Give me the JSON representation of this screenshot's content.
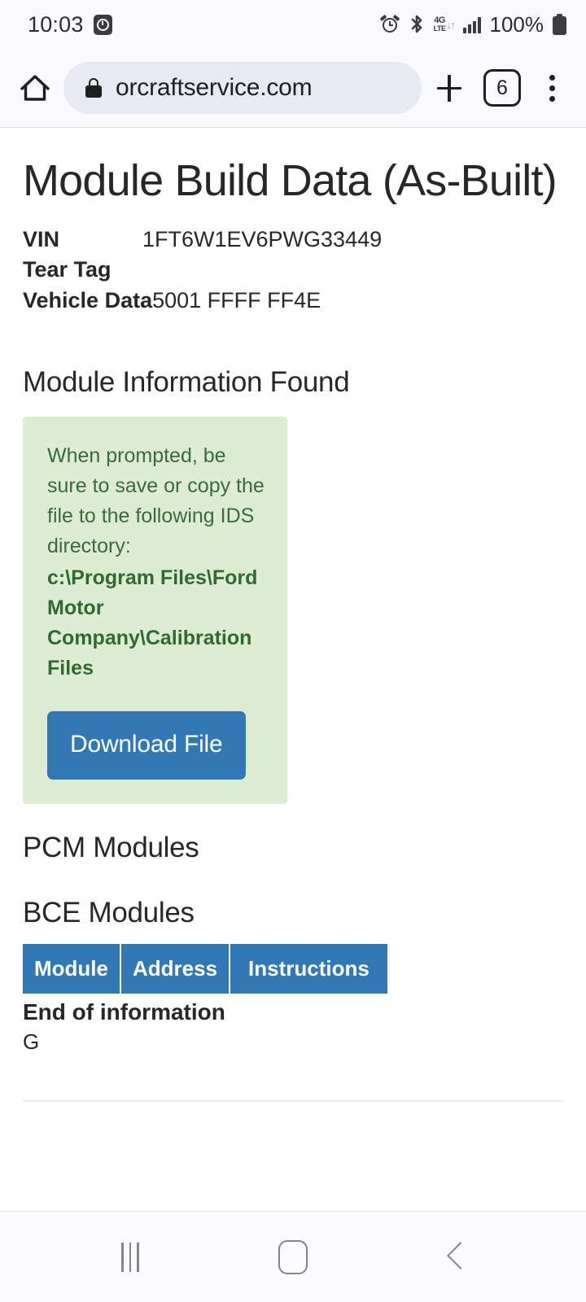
{
  "status_bar": {
    "time": "10:03",
    "battery_percent": "100%",
    "network_label_top": "4G",
    "network_label_bottom": "LTE",
    "icons": [
      "timer-icon",
      "alarm-icon",
      "bluetooth-icon",
      "lte-data-icon",
      "signal-icon",
      "battery-icon"
    ]
  },
  "browser": {
    "url": "orcraftservice.com",
    "tab_count": "6",
    "home_icon": "home-icon",
    "lock_icon": "lock-icon",
    "new_tab_icon": "plus-icon",
    "menu_icon": "kebab-menu-icon"
  },
  "page": {
    "title": "Module Build Data (As-Built)",
    "fields": [
      {
        "label": "VIN",
        "value": "1FT6W1EV6PWG33449"
      },
      {
        "label": "Tear Tag",
        "value": ""
      },
      {
        "label": "Vehicle Data",
        "value": "5001 FFFF FF4E"
      }
    ],
    "module_info_heading": "Module Information Found",
    "alert": {
      "message": "When prompted, be sure to save or copy the file to the following IDS directory:",
      "path": "c:\\Program Files\\Ford Motor Company\\Calibration Files",
      "button_label": "Download File",
      "background_color": "#ddedd3",
      "text_color": "#3a6b3a",
      "button_color": "#3178b4"
    },
    "pcm_heading": "PCM Modules",
    "bce_heading": "BCE Modules",
    "table": {
      "headers": [
        "Module",
        "Address",
        "Instructions"
      ],
      "rows": [],
      "header_background": "#3178b4"
    },
    "end_of_information": "End of information",
    "trailing_text": "G"
  },
  "nav_bar": {
    "recents_icon": "recents-icon",
    "home_icon": "nav-home-icon",
    "back_icon": "back-icon"
  }
}
